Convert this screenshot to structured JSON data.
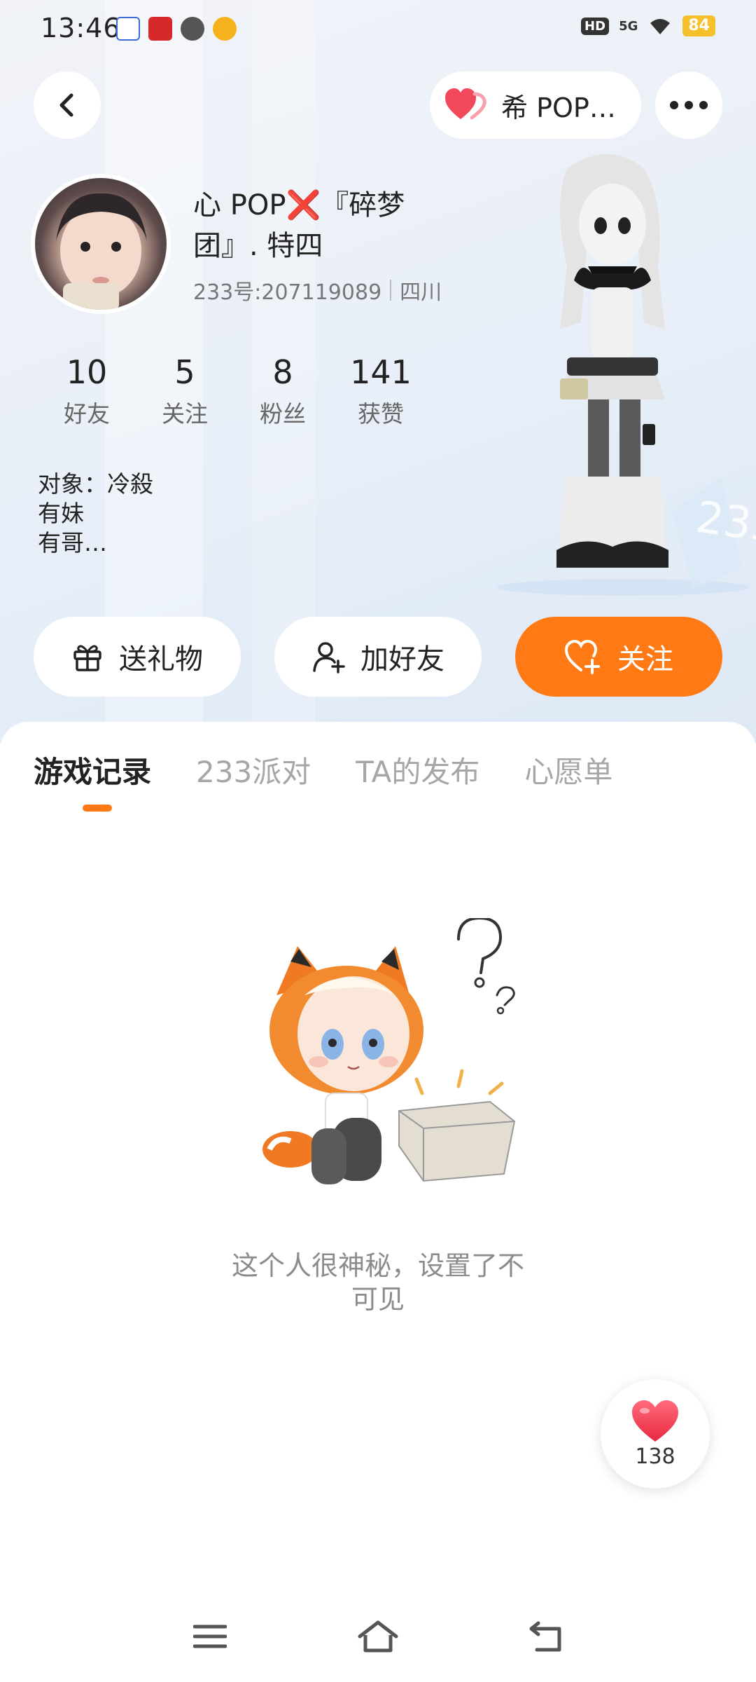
{
  "status_bar": {
    "time": "13:46",
    "hd": "HD",
    "network": "5G",
    "battery": "84"
  },
  "top_bar": {
    "back_icon": "chevron-left-icon",
    "pill_name": "希 POP…",
    "more_icon": "more-horizontal-icon"
  },
  "profile": {
    "nickname_line1": "心 POP❌『碎梦",
    "nickname_line2": "团』. 特四",
    "uid": "233号:207119089",
    "location": "四川",
    "stats": [
      {
        "value": "10",
        "label": "好友"
      },
      {
        "value": "5",
        "label": "关注"
      },
      {
        "value": "8",
        "label": "粉丝"
      },
      {
        "value": "141",
        "label": "获赞"
      }
    ],
    "bio_lines": [
      "对象：冷殺",
      "有妹",
      "有哥…"
    ]
  },
  "actions": {
    "gift_label": "送礼物",
    "add_friend_label": "加好友",
    "follow_label": "关注"
  },
  "tabs": [
    {
      "label": "游戏记录",
      "active": true
    },
    {
      "label": "233派对",
      "active": false
    },
    {
      "label": "TA的发布",
      "active": false
    },
    {
      "label": "心愿单",
      "active": false
    }
  ],
  "empty_state": {
    "message_line1": "这个人很神秘，设置了不",
    "message_line2": "可见"
  },
  "like_float": {
    "count": "138"
  },
  "colors": {
    "accent": "#ff7a14",
    "heart": "#f2485c"
  }
}
